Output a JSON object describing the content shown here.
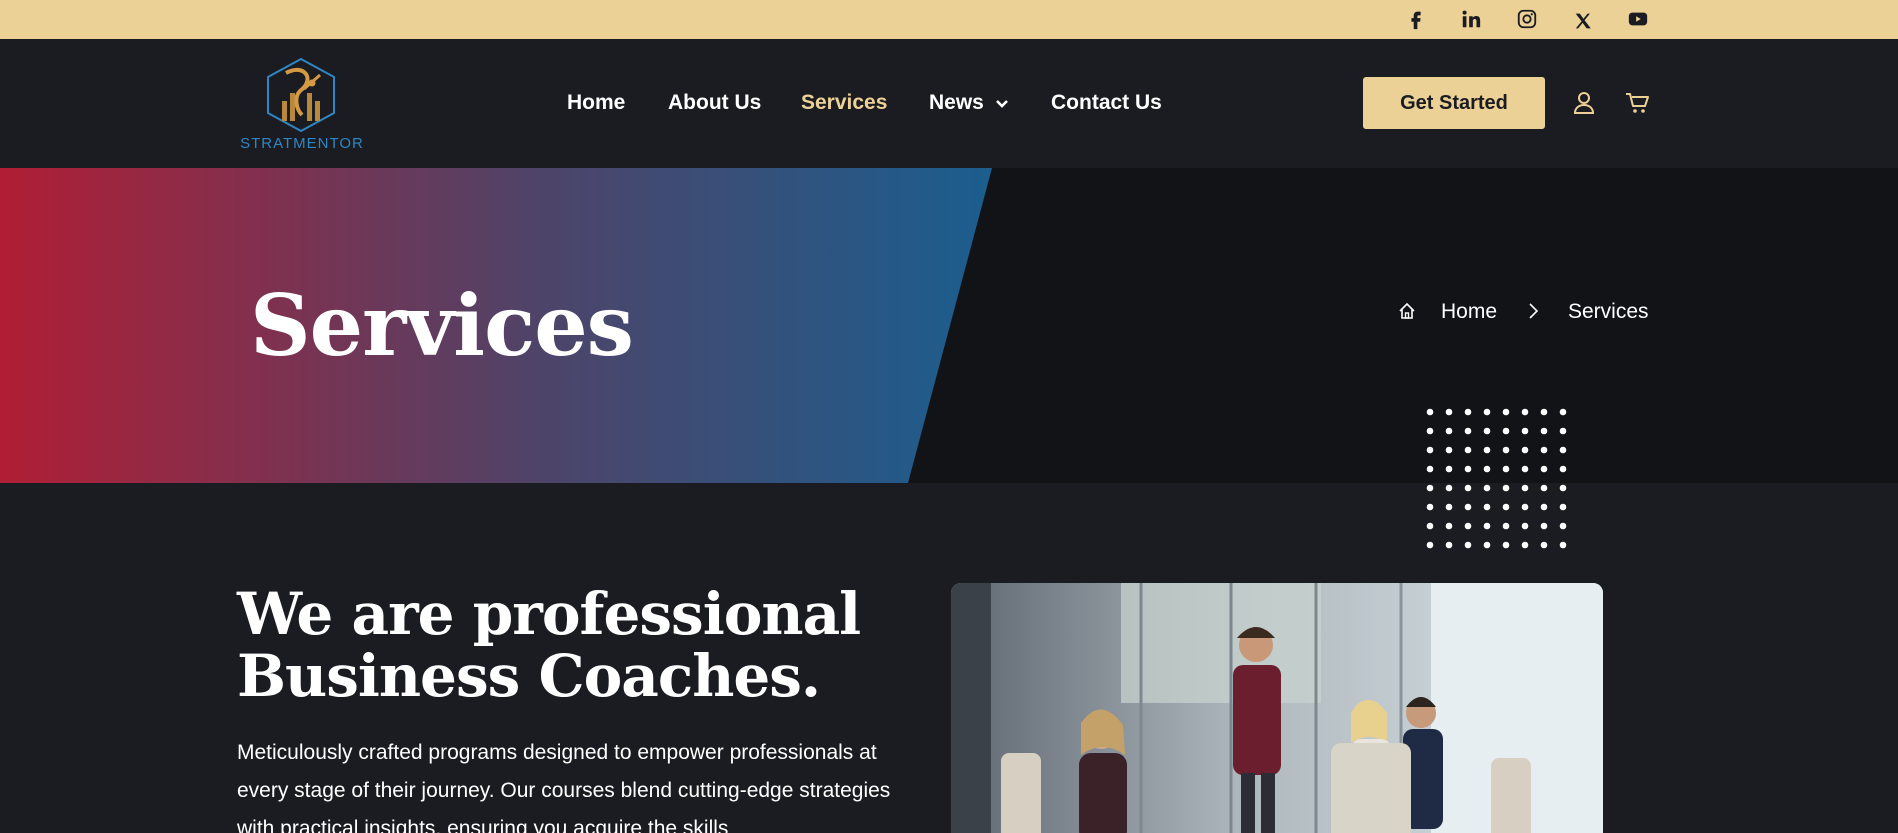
{
  "topbar": {
    "social": [
      "facebook-icon",
      "linkedin-icon",
      "instagram-icon",
      "x-twitter-icon",
      "youtube-icon"
    ]
  },
  "header": {
    "logo_text": "STRATMENTOR",
    "nav": [
      {
        "label": "Home"
      },
      {
        "label": "About Us"
      },
      {
        "label": "Services",
        "active": true
      },
      {
        "label": "News",
        "has_dropdown": true
      },
      {
        "label": "Contact Us"
      }
    ],
    "cta_label": "Get Started",
    "icons": [
      "user-icon",
      "cart-icon"
    ]
  },
  "hero": {
    "title": "Services",
    "breadcrumb": {
      "home": "Home",
      "current": "Services"
    }
  },
  "about": {
    "headline_line1": "We are professional",
    "headline_line2": "Business Coaches.",
    "body": "Meticulously crafted programs designed to empower professionals at every stage of their journey. Our courses blend cutting-edge strategies with practical insights, ensuring you acquire the skills"
  },
  "colors": {
    "accent": "#ecd197",
    "background": "#1b1c21",
    "hero_dark": "#121317",
    "gradient_start": "#b01e35",
    "gradient_end": "#1b5e8f",
    "logo_blue": "#2f86c2"
  }
}
